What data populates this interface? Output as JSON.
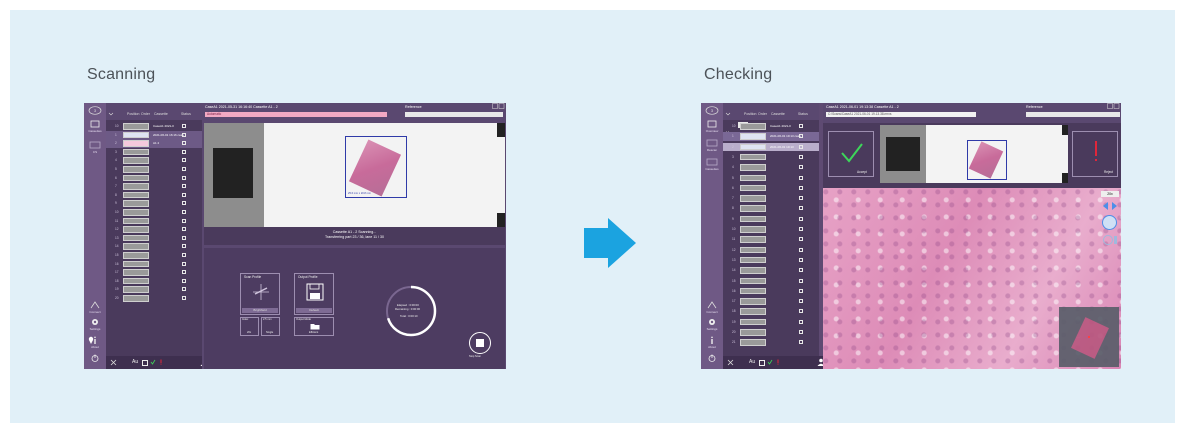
{
  "labels": {
    "left": "Scanning",
    "right": "Checking"
  },
  "colors": {
    "panel_bg": "#e1f0f8",
    "arrow": "#1ba3e0",
    "ui_purple": "#5e4a72",
    "accent_green": "#3dd65a",
    "accent_red": "#e0263a"
  },
  "scanning": {
    "sidebar": {
      "items": [
        "Cassettes",
        "CS"
      ],
      "bottom_items": [
        "Connect",
        "Settings",
        "About"
      ]
    },
    "list": {
      "headers": [
        "Position",
        "Order",
        "Cassette",
        "Status"
      ],
      "filter": "A1",
      "group": "A1",
      "rows": [
        "10",
        "1",
        "2",
        "3",
        "4",
        "5",
        "6",
        "7",
        "8",
        "9",
        "10",
        "11",
        "12",
        "13",
        "14",
        "15",
        "16",
        "17",
        "18",
        "19",
        "20"
      ],
      "row_texts": [
        "CaseA1 2021-0",
        "2021-06-01 16:16 case",
        "A1 2"
      ],
      "footer_label": "Au"
    },
    "title": "CaseA1 2021-05-31 16:16:40 Cassette A1 - 2",
    "mode": "Automatic",
    "reference": "Reference",
    "roi_size": "25.6 mm x 20.8 mm",
    "status_line1": "Cassette A1 - 2 Scanning...",
    "status_line2": "Transferring part 23 / 36, lane 11 / 30",
    "scan_profile": {
      "title": "Scan Profile",
      "value": "Brightfield"
    },
    "output_profile": {
      "title": "Output Profile",
      "value": "Default"
    },
    "sub_options": [
      "Index",
      "2.5 mm",
      "Output Mode"
    ],
    "sub_values": [
      "20x",
      "Single",
      "Efficient"
    ],
    "progress": {
      "elapsed": "Elapsed : 0:00:00",
      "remaining": "Remaining : 0:00:00",
      "total": "Total : 0:00:10",
      "fraction": 0.7
    },
    "stop": "Stop Scan"
  },
  "checking": {
    "sidebar": {
      "items": [
        "Overview",
        "Rescan",
        "Cassettes"
      ],
      "bottom_items": [
        "Connect",
        "Settings",
        "About"
      ]
    },
    "list": {
      "headers": [
        "Position",
        "Order",
        "Cassette",
        "Status"
      ],
      "filter": "A1",
      "group": "A1",
      "rows": [
        "10",
        "1",
        "2",
        "3",
        "4",
        "5",
        "6",
        "7",
        "8",
        "9",
        "10",
        "11",
        "12",
        "13",
        "14",
        "15",
        "16",
        "17",
        "18",
        "19",
        "20",
        "21"
      ],
      "row_texts": [
        "CaseA1 2021-0",
        "2021-06-01 19:13 case",
        "2021-06-01 19:13"
      ],
      "footer_label": "Au"
    },
    "title": "CaseA1 2021-06-01 19:13:38 Cassette A1 - 2",
    "file": "C:\\Scans\\CaseA1 2021-06-01 19.13.38.mrxs",
    "reference": "Reference",
    "accept": "Accept",
    "reject": "Reject",
    "zoom": "20x"
  }
}
